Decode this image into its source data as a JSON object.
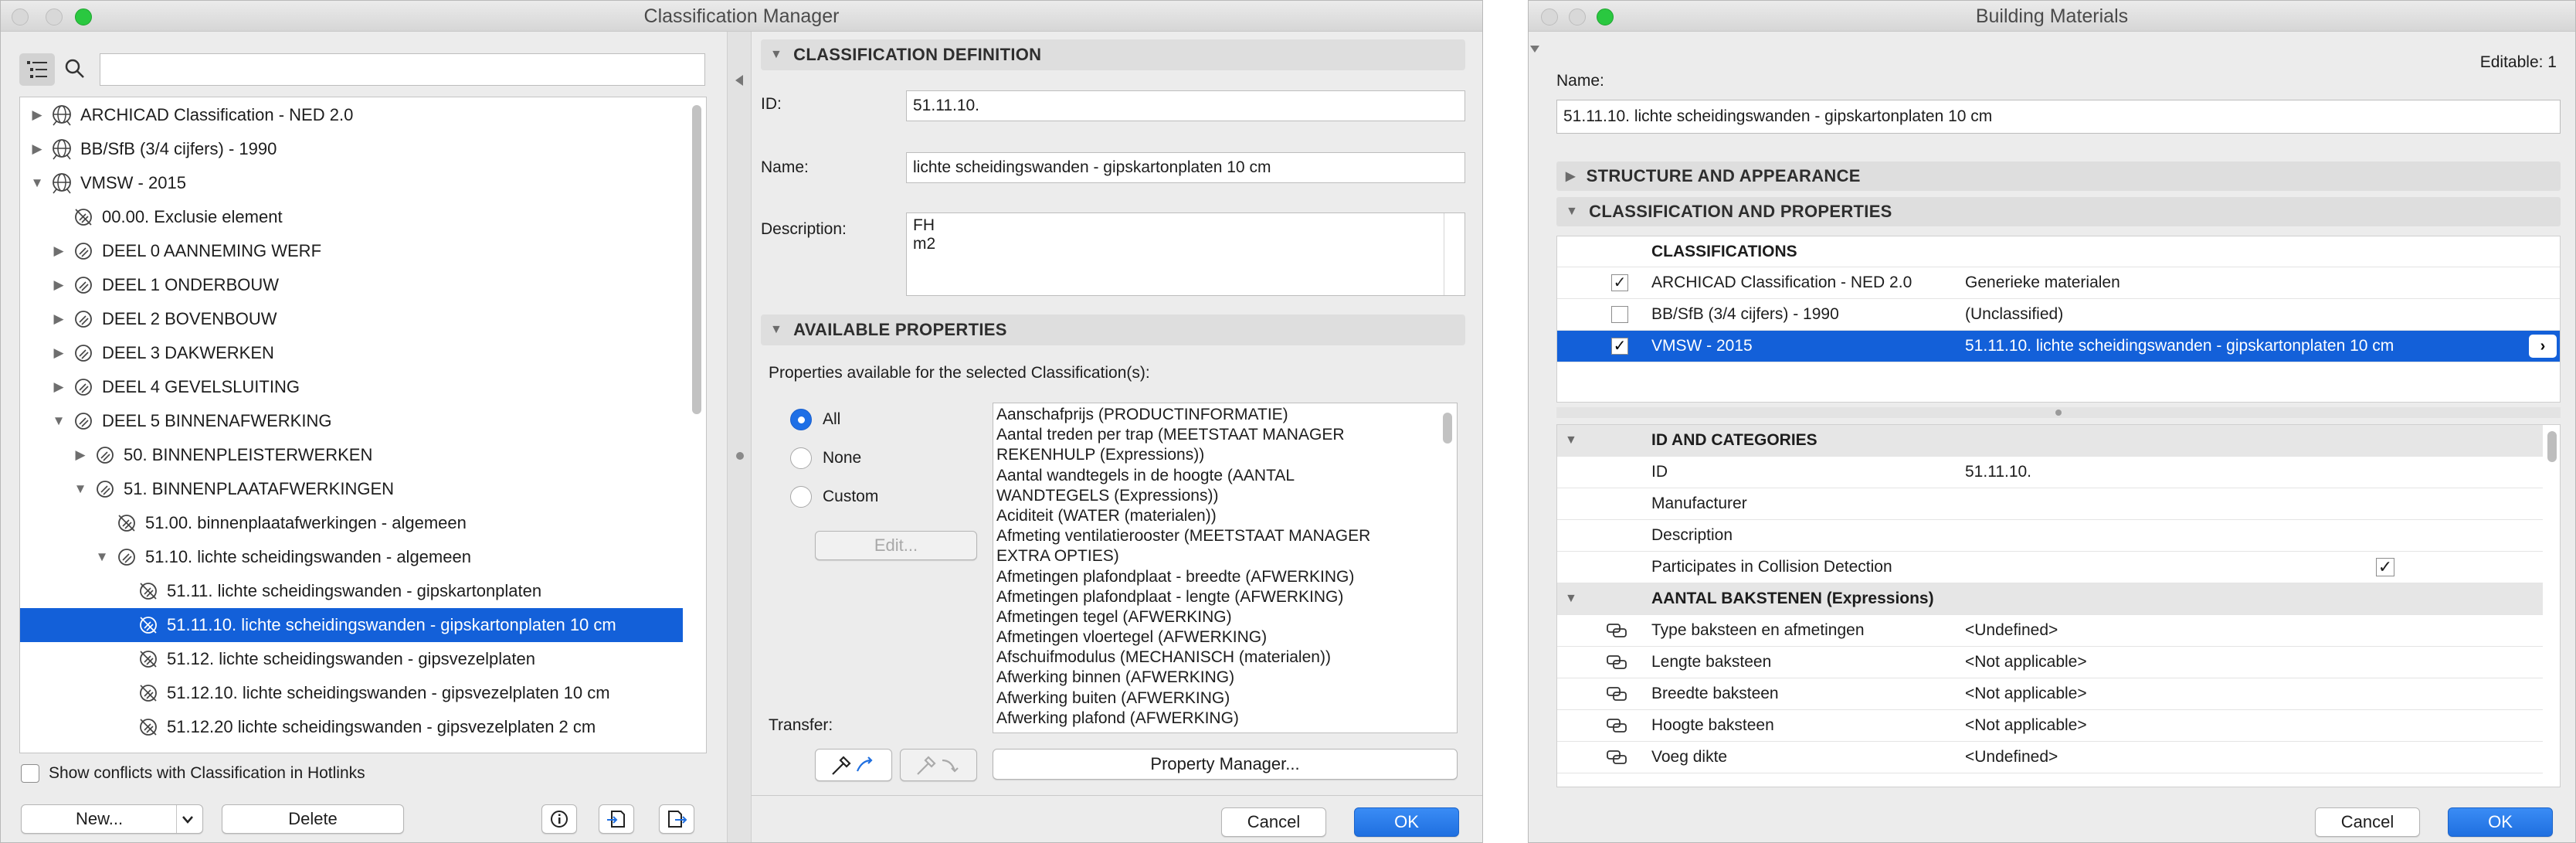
{
  "left_window": {
    "title": "Classification Manager",
    "search_placeholder": "",
    "tree": [
      {
        "label": "ARCHICAD Classification - NED 2.0",
        "expanded": false
      },
      {
        "label": "BB/SfB (3/4 cijfers) - 1990",
        "expanded": false
      },
      {
        "label": "VMSW - 2015",
        "expanded": true
      },
      {
        "label": "00.00. Exclusie element"
      },
      {
        "label": "DEEL 0 AANNEMING WERF"
      },
      {
        "label": "DEEL 1 ONDERBOUW"
      },
      {
        "label": "DEEL 2 BOVENBOUW"
      },
      {
        "label": "DEEL 3 DAKWERKEN"
      },
      {
        "label": "DEEL 4 GEVELSLUITING"
      },
      {
        "label": "DEEL 5 BINNENAFWERKING"
      },
      {
        "label": "50. BINNENPLEISTERWERKEN"
      },
      {
        "label": "51. BINNENPLAATAFWERKINGEN"
      },
      {
        "label": "51.00. binnenplaatafwerkingen - algemeen"
      },
      {
        "label": "51.10. lichte scheidingswanden - algemeen"
      },
      {
        "label": "51.11. lichte scheidingswanden - gipskartonplaten"
      },
      {
        "label": "51.11.10. lichte scheidingswanden - gipskartonplaten 10 cm",
        "selected": true
      },
      {
        "label": "51.12. lichte scheidingswanden - gipsvezelplaten"
      },
      {
        "label": "51.12.10. lichte scheidingswanden - gipsvezelplaten 10 cm"
      },
      {
        "label": "51.12.20 lichte scheidingswanden - gipsvezelplaten 2 cm"
      }
    ],
    "show_conflicts_label": "Show conflicts with Classification in Hotlinks",
    "new_button": "New...",
    "delete_button": "Delete",
    "definition": {
      "section_title": "CLASSIFICATION DEFINITION",
      "id_label": "ID:",
      "id_value": "51.11.10.",
      "name_label": "Name:",
      "name_value": "lichte scheidingswanden - gipskartonplaten 10 cm",
      "description_label": "Description:",
      "description_line1": "FH",
      "description_line2": "m2"
    },
    "properties": {
      "section_title": "AVAILABLE PROPERTIES",
      "subtitle": "Properties available for the selected Classification(s):",
      "radio_all": "All",
      "radio_none": "None",
      "radio_custom": "Custom",
      "edit_button": "Edit...",
      "transfer_label": "Transfer:",
      "property_manager_button": "Property Manager...",
      "list": [
        "Aanschafprijs (PRODUCTINFORMATIE)",
        "Aantal treden per trap (MEETSTAAT MANAGER",
        "REKENHULP (Expressions))",
        "Aantal wandtegels in de hoogte (AANTAL",
        "WANDTEGELS (Expressions))",
        "Aciditeit (WATER (materialen))",
        "Afmeting ventilatierooster (MEETSTAAT MANAGER",
        "EXTRA OPTIES)",
        "Afmetingen plafondplaat - breedte (AFWERKING)",
        "Afmetingen plafondplaat - lengte (AFWERKING)",
        "Afmetingen tegel (AFWERKING)",
        "Afmetingen vloertegel (AFWERKING)",
        "Afschuifmodulus (MECHANISCH (materialen))",
        "Afwerking binnen (AFWERKING)",
        "Afwerking buiten (AFWERKING)",
        "Afwerking plafond (AFWERKING)"
      ]
    },
    "cancel_button": "Cancel",
    "ok_button": "OK"
  },
  "right_window": {
    "title": "Building Materials",
    "editable_label": "Editable: 1",
    "name_label": "Name:",
    "name_value": "51.11.10. lichte scheidingswanden - gipskartonplaten 10 cm",
    "structure_section": "STRUCTURE AND APPEARANCE",
    "classification_section": "CLASSIFICATION AND PROPERTIES",
    "classifications_header": "CLASSIFICATIONS",
    "classifications": [
      {
        "system": "ARCHICAD Classification - NED 2.0",
        "value": "Generieke materialen",
        "checked": true
      },
      {
        "system": "BB/SfB (3/4 cijfers) - 1990",
        "value": "(Unclassified)",
        "checked": false
      },
      {
        "system": "VMSW - 2015",
        "value": "51.11.10. lichte scheidingswanden - gipskartonplaten 10 cm",
        "checked": true,
        "selected": true
      }
    ],
    "id_categories_header": "ID AND CATEGORIES",
    "id_rows": [
      {
        "name": "ID",
        "value": "51.11.10."
      },
      {
        "name": "Manufacturer",
        "value": ""
      },
      {
        "name": "Description",
        "value": ""
      },
      {
        "name": "Participates in Collision Detection",
        "value": ""
      }
    ],
    "bricks_header": "AANTAL BAKSTENEN (Expressions)",
    "brick_rows": [
      {
        "name": "Type baksteen en afmetingen",
        "value": "<Undefined>"
      },
      {
        "name": "Lengte baksteen",
        "value": "<Not applicable>"
      },
      {
        "name": "Breedte baksteen",
        "value": "<Not applicable>"
      },
      {
        "name": "Hoogte baksteen",
        "value": "<Not applicable>"
      },
      {
        "name": "Voeg dikte",
        "value": "<Undefined>"
      }
    ],
    "cancel_button": "Cancel",
    "ok_button": "OK"
  },
  "colors": {
    "selection": "#1360d9",
    "accent": "#1f6fe0"
  }
}
